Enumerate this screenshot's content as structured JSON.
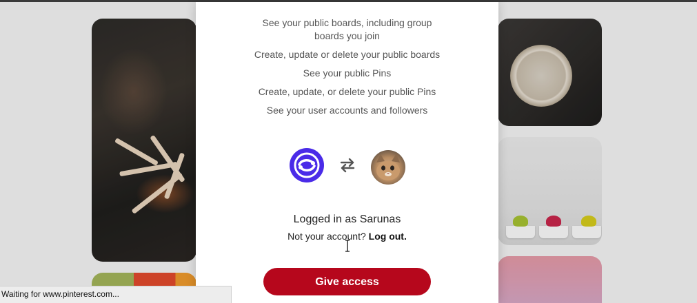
{
  "permissions": [
    "See your public boards, including group boards you join",
    "Create, update or delete your public boards",
    "See your public Pins",
    "Create, update, or delete your public Pins",
    "See your user accounts and followers"
  ],
  "connection": {
    "app_logo_icon": "app-logo-icon",
    "swap_icon": "swap-arrows-icon",
    "user_avatar": "cat-avatar"
  },
  "account": {
    "logged_in_text": "Logged in as Sarunas",
    "not_your_account_text": "Not your account?",
    "logout_label": "Log out."
  },
  "actions": {
    "give_access_label": "Give access",
    "button_color": "#b6071c"
  },
  "status_bar": {
    "text": "Waiting for www.pinterest.com..."
  }
}
